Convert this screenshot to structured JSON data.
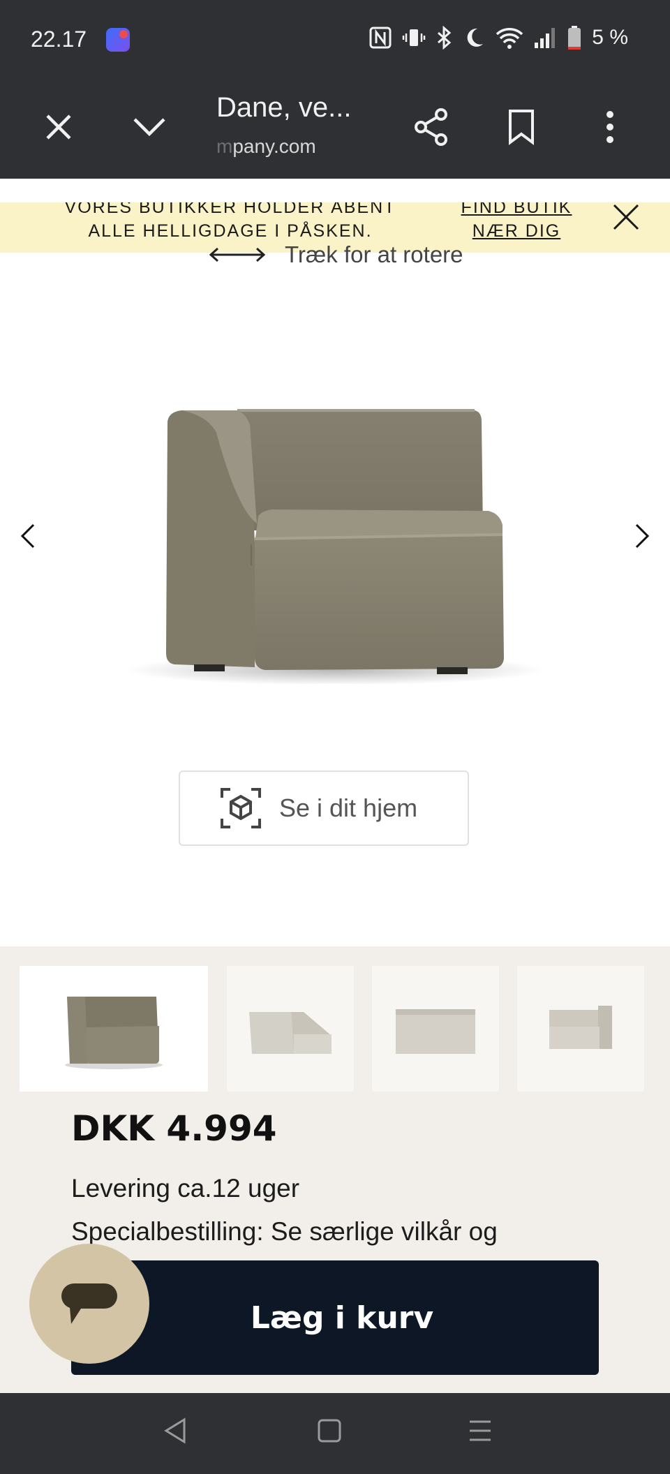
{
  "status_bar": {
    "time": "22.17",
    "battery": "5 %",
    "icons": [
      "app-notification-icon",
      "nfc-icon",
      "vibrate-icon",
      "bluetooth-icon",
      "do-not-disturb-icon",
      "wifi-icon",
      "signal-icon",
      "battery-icon"
    ]
  },
  "browser": {
    "tab_title": "Dane, ve...",
    "url_faded": "m",
    "url": "pany.com",
    "icons": [
      "close-icon",
      "chevron-down-icon",
      "share-icon",
      "bookmark-icon",
      "more-vert-icon"
    ]
  },
  "banner": {
    "message": "VORES BUTIKKER HOLDER ÅBENT ALLE HELLIGDAGE I PÅSKEN.",
    "link": "FIND BUTIK NÆR DIG"
  },
  "viewer": {
    "rotate_hint": "Træk for at rotere",
    "ar_button": "Se i dit hjem"
  },
  "product": {
    "price": "DKK 4.994",
    "delivery": "Levering ca.12 uger",
    "special_order": "Specialbestilling:  Se særlige vilkår og",
    "add_to_cart": "Læg i kurv"
  },
  "colors": {
    "chrome": "#2f3033",
    "banner": "#fbf3c8",
    "cart_button": "#0d1726",
    "chat_bubble": "#d3c4a6",
    "sofa_fabric": "#8a8471",
    "details_bg": "#f2efea"
  }
}
